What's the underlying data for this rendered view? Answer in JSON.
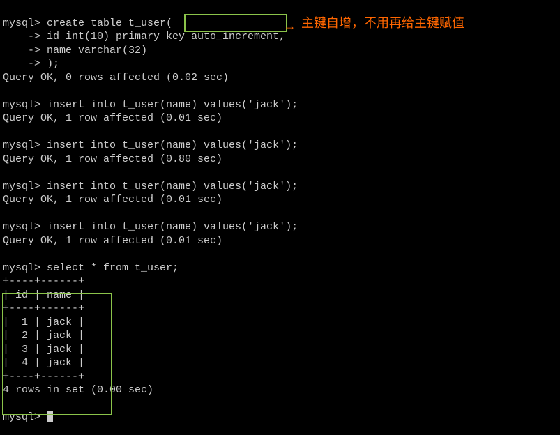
{
  "lines": {
    "l1": "mysql> create table t_user(",
    "l2": "    -> id int(10) primary key auto_increment,",
    "l3": "    -> name varchar(32)",
    "l4": "    -> );",
    "l5": "Query OK, 0 rows affected (0.02 sec)",
    "l6": "",
    "l7": "mysql> insert into t_user(name) values('jack');",
    "l8": "Query OK, 1 row affected (0.01 sec)",
    "l9": "",
    "l10": "mysql> insert into t_user(name) values('jack');",
    "l11": "Query OK, 1 row affected (0.80 sec)",
    "l12": "",
    "l13": "mysql> insert into t_user(name) values('jack');",
    "l14": "Query OK, 1 row affected (0.01 sec)",
    "l15": "",
    "l16": "mysql> insert into t_user(name) values('jack');",
    "l17": "Query OK, 1 row affected (0.01 sec)",
    "l18": "",
    "l19": "mysql> select * from t_user;",
    "l20": "+----+------+",
    "l21": "| id | name |",
    "l22": "+----+------+",
    "l23": "|  1 | jack |",
    "l24": "|  2 | jack |",
    "l25": "|  3 | jack |",
    "l26": "|  4 | jack |",
    "l27": "+----+------+",
    "l28": "4 rows in set (0.00 sec)",
    "l29": "",
    "l30": "mysql> "
  },
  "annotation": "主键自增，不用再给主键赋值",
  "arrow": "→",
  "chart_data": {
    "type": "table",
    "columns": [
      "id",
      "name"
    ],
    "rows": [
      {
        "id": 1,
        "name": "jack"
      },
      {
        "id": 2,
        "name": "jack"
      },
      {
        "id": 3,
        "name": "jack"
      },
      {
        "id": 4,
        "name": "jack"
      }
    ],
    "caption": "t_user"
  }
}
